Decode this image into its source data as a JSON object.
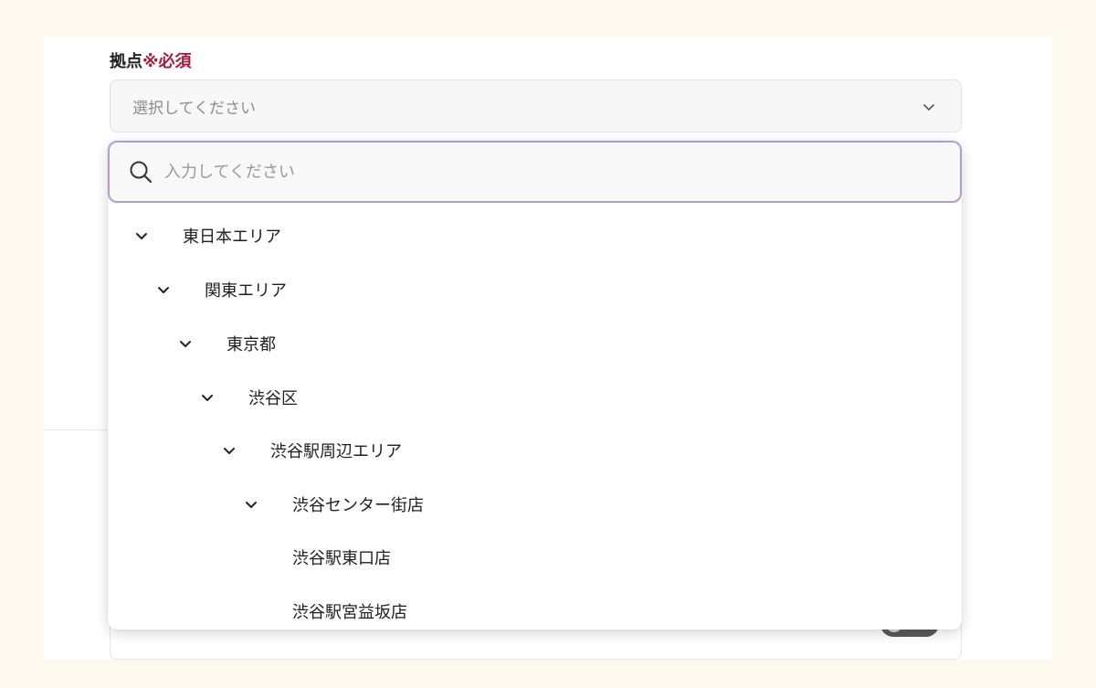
{
  "field": {
    "label": "拠点",
    "required_mark": "※必須",
    "select_placeholder": "選択してください"
  },
  "search": {
    "placeholder": "入力してください"
  },
  "tree": [
    {
      "label": "東日本エリア",
      "level": 0,
      "expanded": true
    },
    {
      "label": "関東エリア",
      "level": 1,
      "expanded": true
    },
    {
      "label": "東京都",
      "level": 2,
      "expanded": true
    },
    {
      "label": "渋谷区",
      "level": 3,
      "expanded": true
    },
    {
      "label": "渋谷駅周辺エリア",
      "level": 4,
      "expanded": true
    },
    {
      "label": "渋谷センター街店",
      "level": 5,
      "expanded": true
    },
    {
      "label": "渋谷駅東口店",
      "level": 6,
      "expanded": false,
      "leaf": true
    },
    {
      "label": "渋谷駅宮益坂店",
      "level": 6,
      "expanded": false,
      "leaf": true
    }
  ],
  "colors": {
    "required": "#a0213f",
    "focus_border": "#b39ad1",
    "toggle": "#5a5a5a"
  },
  "icons": {
    "search": "search-icon",
    "chevron": "chevron-down-icon"
  }
}
